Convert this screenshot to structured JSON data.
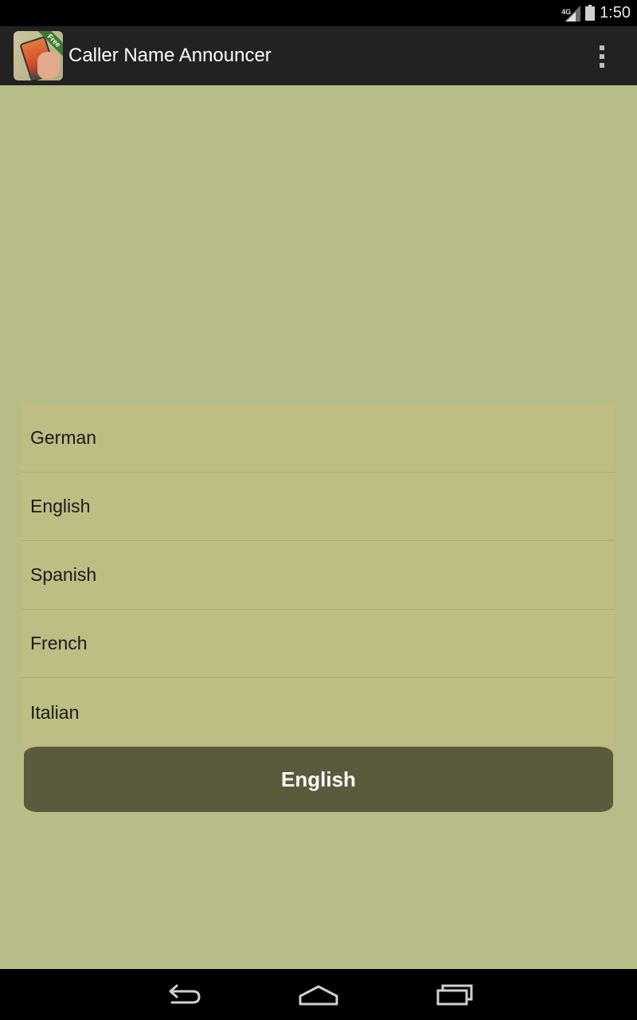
{
  "status_bar": {
    "network": "4G",
    "time": "1:50"
  },
  "action_bar": {
    "title": "Caller Name Announcer",
    "icon_badge": "Free"
  },
  "languages": [
    "German",
    "English",
    "Spanish",
    "French",
    "Italian"
  ],
  "selected_language": "English",
  "colors": {
    "background": "#b8bc87",
    "list_background": "#bdbd84",
    "button": "#5a5a3c",
    "action_bar": "#222222"
  },
  "icons": {
    "overflow": "overflow-menu-icon",
    "back": "back-icon",
    "home": "home-icon",
    "recents": "recents-icon"
  }
}
